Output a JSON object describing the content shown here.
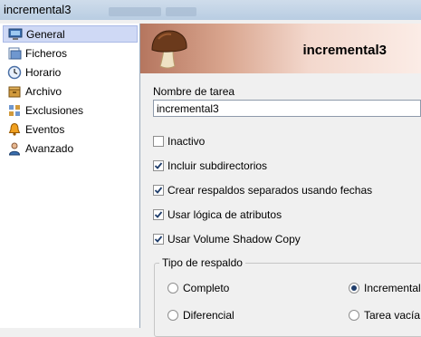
{
  "window": {
    "title": "incremental3"
  },
  "sidebar": {
    "items": [
      {
        "label": "General",
        "icon": "computer-icon",
        "selected": true
      },
      {
        "label": "Ficheros",
        "icon": "folder-icon",
        "selected": false
      },
      {
        "label": "Horario",
        "icon": "clock-icon",
        "selected": false
      },
      {
        "label": "Archivo",
        "icon": "archive-icon",
        "selected": false
      },
      {
        "label": "Exclusiones",
        "icon": "exclusions-icon",
        "selected": false
      },
      {
        "label": "Eventos",
        "icon": "bell-icon",
        "selected": false
      },
      {
        "label": "Avanzado",
        "icon": "advanced-icon",
        "selected": false
      }
    ]
  },
  "banner": {
    "task_name": "incremental3",
    "icon": "mushroom-icon"
  },
  "form": {
    "task_name_label": "Nombre de tarea",
    "task_name_value": "incremental3",
    "checkboxes": [
      {
        "label": "Inactivo",
        "checked": false
      },
      {
        "label": "Incluir subdirectorios",
        "checked": true
      },
      {
        "label": "Crear respaldos separados usando fechas",
        "checked": true
      },
      {
        "label": "Usar lógica de atributos",
        "checked": true
      },
      {
        "label": "Usar Volume Shadow Copy",
        "checked": true
      }
    ],
    "backup_type": {
      "title": "Tipo de respaldo",
      "options": [
        {
          "label": "Completo",
          "selected": false
        },
        {
          "label": "Incremental",
          "selected": true
        },
        {
          "label": "Diferencial",
          "selected": false
        },
        {
          "label": "Tarea vacía",
          "selected": false
        }
      ]
    }
  }
}
